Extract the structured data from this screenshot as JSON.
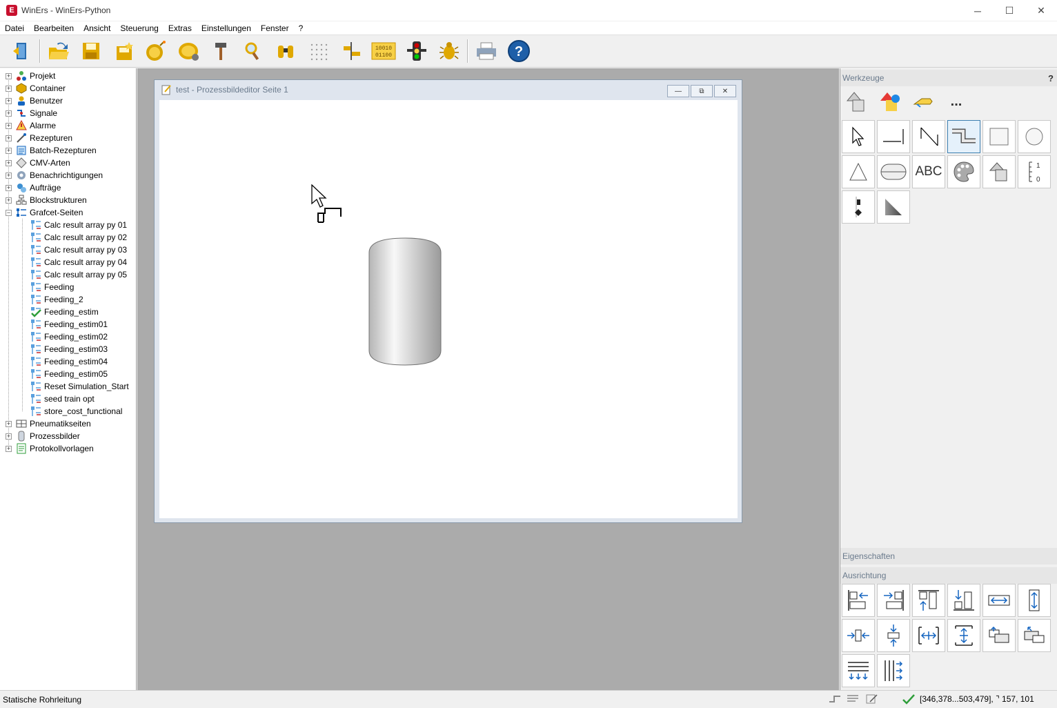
{
  "window": {
    "app_icon_letter": "E",
    "title": "WinErs - WinErs-Python",
    "minimize": "─",
    "maximize": "☐",
    "close": "✕"
  },
  "menu": [
    "Datei",
    "Bearbeiten",
    "Ansicht",
    "Steuerung",
    "Extras",
    "Einstellungen",
    "Fenster",
    "?"
  ],
  "toolbar": {
    "icons": [
      "exit-icon",
      "open-folder-icon",
      "save-icon",
      "new-project-icon",
      "bomb-icon",
      "lemon-icon",
      "hammer-icon",
      "magnifier-icon",
      "binoculars-icon",
      "grid-icon",
      "align-icon",
      "binary-icon",
      "traffic-light-icon",
      "bug-icon",
      "printer-icon",
      "help-icon"
    ],
    "binary_text": "10010 01100",
    "help_text": "?"
  },
  "tree": {
    "top_items": [
      {
        "label": "Projekt",
        "icon": "project-icon"
      },
      {
        "label": "Container",
        "icon": "container-icon"
      },
      {
        "label": "Benutzer",
        "icon": "user-icon"
      },
      {
        "label": "Signale",
        "icon": "signal-icon"
      },
      {
        "label": "Alarme",
        "icon": "alarm-icon"
      },
      {
        "label": "Rezepturen",
        "icon": "recipe-icon"
      },
      {
        "label": "Batch-Rezepturen",
        "icon": "batch-icon"
      },
      {
        "label": "CMV-Arten",
        "icon": "cmv-icon"
      },
      {
        "label": "Benachrichtigungen",
        "icon": "notification-icon"
      },
      {
        "label": "Aufträge",
        "icon": "order-icon"
      },
      {
        "label": "Blockstrukturen",
        "icon": "block-icon"
      },
      {
        "label": "Grafcet-Seiten",
        "icon": "grafcet-icon"
      }
    ],
    "grafcet_children": [
      "Calc result array py 01",
      "Calc result array py 02",
      "Calc result array py 03",
      "Calc result array py 04",
      "Calc result array py 05",
      "Feeding",
      "Feeding_2",
      "Feeding_estim",
      "Feeding_estim01",
      "Feeding_estim02",
      "Feeding_estim03",
      "Feeding_estim04",
      "Feeding_estim05",
      "Reset Simulation_Start",
      "seed train opt",
      "store_cost_functional"
    ],
    "bottom_items": [
      {
        "label": "Pneumatikseiten",
        "icon": "pneumatic-icon"
      },
      {
        "label": "Prozessbilder",
        "icon": "process-image-icon"
      },
      {
        "label": "Protokollvorlagen",
        "icon": "protocol-icon"
      }
    ]
  },
  "child_window": {
    "title": "test - Prozessbildeditor Seite 1",
    "minimize": "—",
    "restore": "⧉",
    "close": "✕"
  },
  "tools_panel": {
    "title": "Werkzeuge",
    "help": "?",
    "tabs": [
      "shapes-tab-icon",
      "colored-shapes-tab-icon",
      "hand-tab-icon",
      "more-tab-icon"
    ],
    "more_label": "...",
    "abc_label": "ABC",
    "scale_label_top": "1",
    "scale_label_bottom": "0"
  },
  "properties_panel": {
    "title": "Eigenschaften"
  },
  "alignment_panel": {
    "title": "Ausrichtung"
  },
  "statusbar": {
    "left": "Statische Rohrleitung",
    "right": "[346,378...503,479], ⌝ 157, 101"
  }
}
